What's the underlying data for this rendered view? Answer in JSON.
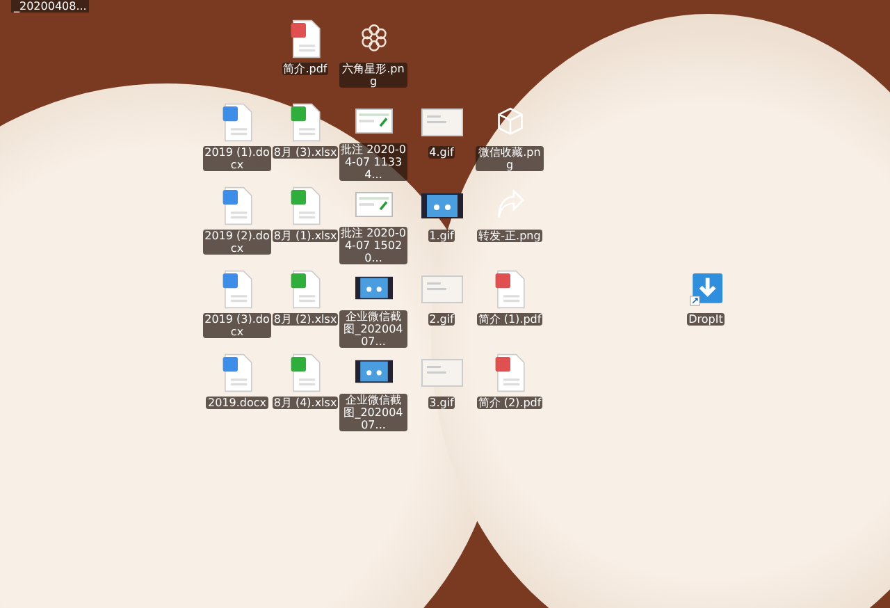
{
  "corner_label": "_20200408...",
  "icon_rows": [
    [
      {
        "kind": "pdf",
        "label": "简介.pdf"
      },
      {
        "kind": "flower",
        "label": "六角星形.png"
      }
    ],
    [
      {
        "kind": "word",
        "label": "2019 (1).docx"
      },
      {
        "kind": "excel",
        "label": "8月 (3).xlsx"
      },
      {
        "kind": "screenshot",
        "label": "批注 2020-04-07 11334..."
      },
      {
        "kind": "gif",
        "label": "4.gif"
      },
      {
        "kind": "cube",
        "label": "微信收藏.png"
      }
    ],
    [
      {
        "kind": "word",
        "label": "2019 (2).docx"
      },
      {
        "kind": "excel",
        "label": "8月 (1).xlsx"
      },
      {
        "kind": "screenshot",
        "label": "批注 2020-04-07 15020..."
      },
      {
        "kind": "video",
        "label": "1.gif"
      },
      {
        "kind": "share",
        "label": "转发-正.png"
      }
    ],
    [
      {
        "kind": "word",
        "label": "2019 (3).docx"
      },
      {
        "kind": "excel",
        "label": "8月 (2).xlsx"
      },
      {
        "kind": "video",
        "label": "企业微信截图_20200407..."
      },
      {
        "kind": "gif",
        "label": "2.gif"
      },
      {
        "kind": "pdf",
        "label": "简介 (1).pdf"
      }
    ],
    [
      {
        "kind": "word",
        "label": "2019.docx"
      },
      {
        "kind": "excel",
        "label": "8月 (4).xlsx"
      },
      {
        "kind": "video",
        "label": "企业微信截图_20200407..."
      },
      {
        "kind": "gif",
        "label": "3.gif"
      },
      {
        "kind": "pdf",
        "label": "简介 (2).pdf"
      }
    ]
  ],
  "shortcut": {
    "kind": "dropit",
    "label": "DropIt"
  }
}
